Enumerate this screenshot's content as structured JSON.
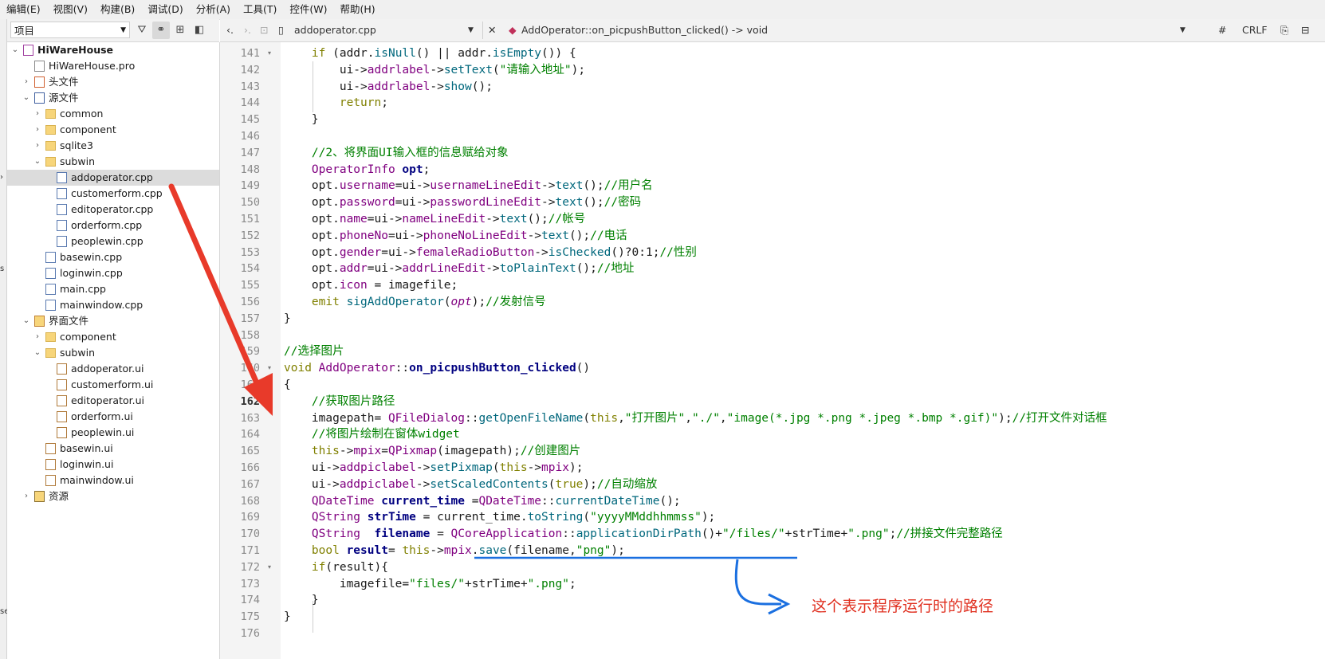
{
  "menubar": [
    "编辑(E)",
    "视图(V)",
    "构建(B)",
    "调试(D)",
    "分析(A)",
    "工具(T)",
    "控件(W)",
    "帮助(H)"
  ],
  "left_strip": {
    "top": "›",
    "mid": "s",
    "bottom": "se"
  },
  "project_panel": {
    "selector": "项目",
    "tree": [
      {
        "label": "HiWareHouse",
        "level": 0,
        "icon": "proj",
        "expander": "v",
        "bold": true
      },
      {
        "label": "HiWareHouse.pro",
        "level": 1,
        "icon": "file",
        "expander": ""
      },
      {
        "label": "头文件",
        "level": 1,
        "icon": "hdr",
        "expander": ">"
      },
      {
        "label": "源文件",
        "level": 1,
        "icon": "srcg",
        "expander": "v"
      },
      {
        "label": "common",
        "level": 2,
        "icon": "folder",
        "expander": ">"
      },
      {
        "label": "component",
        "level": 2,
        "icon": "folder",
        "expander": ">"
      },
      {
        "label": "sqlite3",
        "level": 2,
        "icon": "folder",
        "expander": ">"
      },
      {
        "label": "subwin",
        "level": 2,
        "icon": "folder",
        "expander": "v"
      },
      {
        "label": "addoperator.cpp",
        "level": 3,
        "icon": "cpp",
        "expander": "",
        "selected": true
      },
      {
        "label": "customerform.cpp",
        "level": 3,
        "icon": "cpp",
        "expander": ""
      },
      {
        "label": "editoperator.cpp",
        "level": 3,
        "icon": "cpp",
        "expander": ""
      },
      {
        "label": "orderform.cpp",
        "level": 3,
        "icon": "cpp",
        "expander": ""
      },
      {
        "label": "peoplewin.cpp",
        "level": 3,
        "icon": "cpp",
        "expander": ""
      },
      {
        "label": "basewin.cpp",
        "level": 2,
        "icon": "cpp",
        "expander": ""
      },
      {
        "label": "loginwin.cpp",
        "level": 2,
        "icon": "cpp",
        "expander": ""
      },
      {
        "label": "main.cpp",
        "level": 2,
        "icon": "cpp",
        "expander": ""
      },
      {
        "label": "mainwindow.cpp",
        "level": 2,
        "icon": "cpp",
        "expander": ""
      },
      {
        "label": "界面文件",
        "level": 1,
        "icon": "uig",
        "expander": "v"
      },
      {
        "label": "component",
        "level": 2,
        "icon": "folder",
        "expander": ">"
      },
      {
        "label": "subwin",
        "level": 2,
        "icon": "folder",
        "expander": "v"
      },
      {
        "label": "addoperator.ui",
        "level": 3,
        "icon": "ui",
        "expander": ""
      },
      {
        "label": "customerform.ui",
        "level": 3,
        "icon": "ui",
        "expander": ""
      },
      {
        "label": "editoperator.ui",
        "level": 3,
        "icon": "ui",
        "expander": ""
      },
      {
        "label": "orderform.ui",
        "level": 3,
        "icon": "ui",
        "expander": ""
      },
      {
        "label": "peoplewin.ui",
        "level": 3,
        "icon": "ui",
        "expander": ""
      },
      {
        "label": "basewin.ui",
        "level": 2,
        "icon": "ui",
        "expander": ""
      },
      {
        "label": "loginwin.ui",
        "level": 2,
        "icon": "ui",
        "expander": ""
      },
      {
        "label": "mainwindow.ui",
        "level": 2,
        "icon": "ui",
        "expander": ""
      },
      {
        "label": "资源",
        "level": 1,
        "icon": "res",
        "expander": ">"
      }
    ]
  },
  "editor_toolbar": {
    "file": "addoperator.cpp",
    "function": "AddOperator::on_picpushButton_clicked() -> void",
    "hash": "#",
    "line_ending": "CRLF"
  },
  "current_line": 162,
  "colors": {
    "keyword": "#808000",
    "type": "#800080",
    "method": "#00677c",
    "string": "#008000",
    "comment": "#008000",
    "bold_name": "#00677c",
    "annotation": "#e03020",
    "blue_ink": "#1a6fe0"
  },
  "code_lines": [
    {
      "n": 141,
      "fold": true,
      "segs": [
        [
          "    ",
          ""
        ],
        [
          "if",
          "kw"
        ],
        [
          " (addr.",
          ""
        ],
        [
          "isNull",
          "m"
        ],
        [
          "() || addr.",
          ""
        ],
        [
          "isEmpty",
          "m"
        ],
        [
          "()) {",
          ""
        ]
      ]
    },
    {
      "n": 142,
      "segs": [
        [
          "        ui->",
          ""
        ],
        [
          "addrlabel",
          "f"
        ],
        [
          "->",
          ""
        ],
        [
          "setText",
          "m"
        ],
        [
          "(",
          ""
        ],
        [
          "\"请输入地址\"",
          "s"
        ],
        [
          ");",
          ""
        ]
      ]
    },
    {
      "n": 143,
      "segs": [
        [
          "        ui->",
          ""
        ],
        [
          "addrlabel",
          "f"
        ],
        [
          "->",
          ""
        ],
        [
          "show",
          "m"
        ],
        [
          "();",
          ""
        ]
      ]
    },
    {
      "n": 144,
      "segs": [
        [
          "        ",
          ""
        ],
        [
          "return",
          "kw"
        ],
        [
          ";",
          ""
        ]
      ]
    },
    {
      "n": 145,
      "segs": [
        [
          "    }",
          ""
        ]
      ]
    },
    {
      "n": 146,
      "segs": []
    },
    {
      "n": 147,
      "segs": [
        [
          "    ",
          ""
        ],
        [
          "//2、将界面UI输入框的信息赋给对象",
          "c"
        ]
      ]
    },
    {
      "n": 148,
      "segs": [
        [
          "    ",
          ""
        ],
        [
          "OperatorInfo",
          "t"
        ],
        [
          " ",
          ""
        ],
        [
          "opt",
          "b"
        ],
        [
          ";",
          ""
        ]
      ]
    },
    {
      "n": 149,
      "segs": [
        [
          "    opt.",
          ""
        ],
        [
          "username",
          "f"
        ],
        [
          "=ui->",
          ""
        ],
        [
          "usernameLineEdit",
          "f"
        ],
        [
          "->",
          ""
        ],
        [
          "text",
          "m"
        ],
        [
          "();",
          ""
        ],
        [
          "//用户名",
          "c"
        ]
      ]
    },
    {
      "n": 150,
      "segs": [
        [
          "    opt.",
          ""
        ],
        [
          "password",
          "f"
        ],
        [
          "=ui->",
          ""
        ],
        [
          "passwordLineEdit",
          "f"
        ],
        [
          "->",
          ""
        ],
        [
          "text",
          "m"
        ],
        [
          "();",
          ""
        ],
        [
          "//密码",
          "c"
        ]
      ]
    },
    {
      "n": 151,
      "segs": [
        [
          "    opt.",
          ""
        ],
        [
          "name",
          "f"
        ],
        [
          "=ui->",
          ""
        ],
        [
          "nameLineEdit",
          "f"
        ],
        [
          "->",
          ""
        ],
        [
          "text",
          "m"
        ],
        [
          "();",
          ""
        ],
        [
          "//帐号",
          "c"
        ]
      ]
    },
    {
      "n": 152,
      "segs": [
        [
          "    opt.",
          ""
        ],
        [
          "phoneNo",
          "f"
        ],
        [
          "=ui->",
          ""
        ],
        [
          "phoneNoLineEdit",
          "f"
        ],
        [
          "->",
          ""
        ],
        [
          "text",
          "m"
        ],
        [
          "();",
          ""
        ],
        [
          "//电话",
          "c"
        ]
      ]
    },
    {
      "n": 153,
      "segs": [
        [
          "    opt.",
          ""
        ],
        [
          "gender",
          "f"
        ],
        [
          "=ui->",
          ""
        ],
        [
          "femaleRadioButton",
          "f"
        ],
        [
          "->",
          ""
        ],
        [
          "isChecked",
          "m"
        ],
        [
          "()?0:1;",
          ""
        ],
        [
          "//性别",
          "c"
        ]
      ]
    },
    {
      "n": 154,
      "segs": [
        [
          "    opt.",
          ""
        ],
        [
          "addr",
          "f"
        ],
        [
          "=ui->",
          ""
        ],
        [
          "addrLineEdit",
          "f"
        ],
        [
          "->",
          ""
        ],
        [
          "toPlainText",
          "m"
        ],
        [
          "();",
          ""
        ],
        [
          "//地址",
          "c"
        ]
      ]
    },
    {
      "n": 155,
      "segs": [
        [
          "    opt.",
          ""
        ],
        [
          "icon",
          "f"
        ],
        [
          " = imagefile;",
          ""
        ]
      ]
    },
    {
      "n": 156,
      "segs": [
        [
          "    ",
          ""
        ],
        [
          "emit",
          "kw"
        ],
        [
          " ",
          ""
        ],
        [
          "sigAddOperator",
          "m"
        ],
        [
          "(",
          ""
        ],
        [
          "opt",
          "i"
        ],
        [
          ");",
          ""
        ],
        [
          "//发射信号",
          "c"
        ]
      ]
    },
    {
      "n": 157,
      "segs": [
        [
          "}",
          ""
        ]
      ]
    },
    {
      "n": 158,
      "segs": []
    },
    {
      "n": 159,
      "segs": [
        [
          "//选择图片",
          "c"
        ]
      ]
    },
    {
      "n": 160,
      "fold": true,
      "segs": [
        [
          "void",
          "kw"
        ],
        [
          " ",
          ""
        ],
        [
          "AddOperator",
          "t"
        ],
        [
          "::",
          ""
        ],
        [
          "on_picpushButton_clicked",
          "b"
        ],
        [
          "()",
          ""
        ]
      ]
    },
    {
      "n": 161,
      "segs": [
        [
          "{",
          ""
        ]
      ]
    },
    {
      "n": 162,
      "segs": [
        [
          "    ",
          ""
        ],
        [
          "//获取图片路径",
          "c"
        ]
      ]
    },
    {
      "n": 163,
      "segs": [
        [
          "    imagepath= ",
          ""
        ],
        [
          "QFileDialog",
          "t"
        ],
        [
          "::",
          ""
        ],
        [
          "getOpenFileName",
          "m"
        ],
        [
          "(",
          ""
        ],
        [
          "this",
          "kw"
        ],
        [
          ",",
          ""
        ],
        [
          "\"打开图片\"",
          "s"
        ],
        [
          ",",
          ""
        ],
        [
          "\"./\"",
          "s"
        ],
        [
          ",",
          ""
        ],
        [
          "\"image(*.jpg *.png *.jpeg *.bmp *.gif)\"",
          "s"
        ],
        [
          ");",
          ""
        ],
        [
          "//打开文件对话框",
          "c"
        ]
      ]
    },
    {
      "n": 164,
      "segs": [
        [
          "    ",
          ""
        ],
        [
          "//将图片绘制在窗体widget",
          "c"
        ]
      ]
    },
    {
      "n": 165,
      "segs": [
        [
          "    ",
          ""
        ],
        [
          "this",
          "kw"
        ],
        [
          "->",
          ""
        ],
        [
          "mpix",
          "f"
        ],
        [
          "=",
          ""
        ],
        [
          "QPixmap",
          "t"
        ],
        [
          "(imagepath);",
          ""
        ],
        [
          "//创建图片",
          "c"
        ]
      ]
    },
    {
      "n": 166,
      "segs": [
        [
          "    ui->",
          ""
        ],
        [
          "addpiclabel",
          "f"
        ],
        [
          "->",
          ""
        ],
        [
          "setPixmap",
          "m"
        ],
        [
          "(",
          ""
        ],
        [
          "this",
          "kw"
        ],
        [
          "->",
          ""
        ],
        [
          "mpix",
          "f"
        ],
        [
          ");",
          ""
        ]
      ]
    },
    {
      "n": 167,
      "segs": [
        [
          "    ui->",
          ""
        ],
        [
          "addpiclabel",
          "f"
        ],
        [
          "->",
          ""
        ],
        [
          "setScaledContents",
          "m"
        ],
        [
          "(",
          ""
        ],
        [
          "true",
          "kw"
        ],
        [
          ");",
          ""
        ],
        [
          "//自动缩放",
          "c"
        ]
      ]
    },
    {
      "n": 168,
      "segs": [
        [
          "    ",
          ""
        ],
        [
          "QDateTime",
          "t"
        ],
        [
          " ",
          ""
        ],
        [
          "current_time",
          "b"
        ],
        [
          " =",
          ""
        ],
        [
          "QDateTime",
          "t"
        ],
        [
          "::",
          ""
        ],
        [
          "currentDateTime",
          "m"
        ],
        [
          "();",
          ""
        ]
      ]
    },
    {
      "n": 169,
      "segs": [
        [
          "    ",
          ""
        ],
        [
          "QString",
          "t"
        ],
        [
          " ",
          ""
        ],
        [
          "strTime",
          "b"
        ],
        [
          " = current_time.",
          ""
        ],
        [
          "toString",
          "m"
        ],
        [
          "(",
          ""
        ],
        [
          "\"yyyyMMddhhmmss\"",
          "s"
        ],
        [
          ");",
          ""
        ]
      ]
    },
    {
      "n": 170,
      "segs": [
        [
          "    ",
          ""
        ],
        [
          "QString",
          "t"
        ],
        [
          "  ",
          ""
        ],
        [
          "filename",
          "b"
        ],
        [
          " = ",
          ""
        ],
        [
          "QCoreApplication",
          "t"
        ],
        [
          "::",
          ""
        ],
        [
          "applicationDirPath",
          "m"
        ],
        [
          "()+",
          ""
        ],
        [
          "\"/files/\"",
          "s"
        ],
        [
          "+strTime+",
          ""
        ],
        [
          "\".png\"",
          "s"
        ],
        [
          ";",
          ""
        ],
        [
          "//拼接文件完整路径",
          "c"
        ]
      ]
    },
    {
      "n": 171,
      "segs": [
        [
          "    ",
          ""
        ],
        [
          "bool",
          "kw"
        ],
        [
          " ",
          ""
        ],
        [
          "result",
          "b"
        ],
        [
          "= ",
          ""
        ],
        [
          "this",
          "kw"
        ],
        [
          "->",
          ""
        ],
        [
          "mpix",
          "f"
        ],
        [
          ".",
          ""
        ],
        [
          "save",
          "m"
        ],
        [
          "(filename,",
          ""
        ],
        [
          "\"png\"",
          "s"
        ],
        [
          ");",
          ""
        ]
      ]
    },
    {
      "n": 172,
      "fold": true,
      "segs": [
        [
          "    ",
          ""
        ],
        [
          "if",
          "kw"
        ],
        [
          "(result){",
          ""
        ]
      ]
    },
    {
      "n": 173,
      "segs": [
        [
          "        imagefile=",
          ""
        ],
        [
          "\"files/\"",
          "s"
        ],
        [
          "+strTime+",
          ""
        ],
        [
          "\".png\"",
          "s"
        ],
        [
          ";",
          ""
        ]
      ]
    },
    {
      "n": 174,
      "segs": [
        [
          "    }",
          ""
        ]
      ]
    },
    {
      "n": 175,
      "segs": [
        [
          "}",
          ""
        ]
      ]
    },
    {
      "n": 176,
      "segs": []
    }
  ],
  "annotation": "这个表示程序运行时的路径"
}
